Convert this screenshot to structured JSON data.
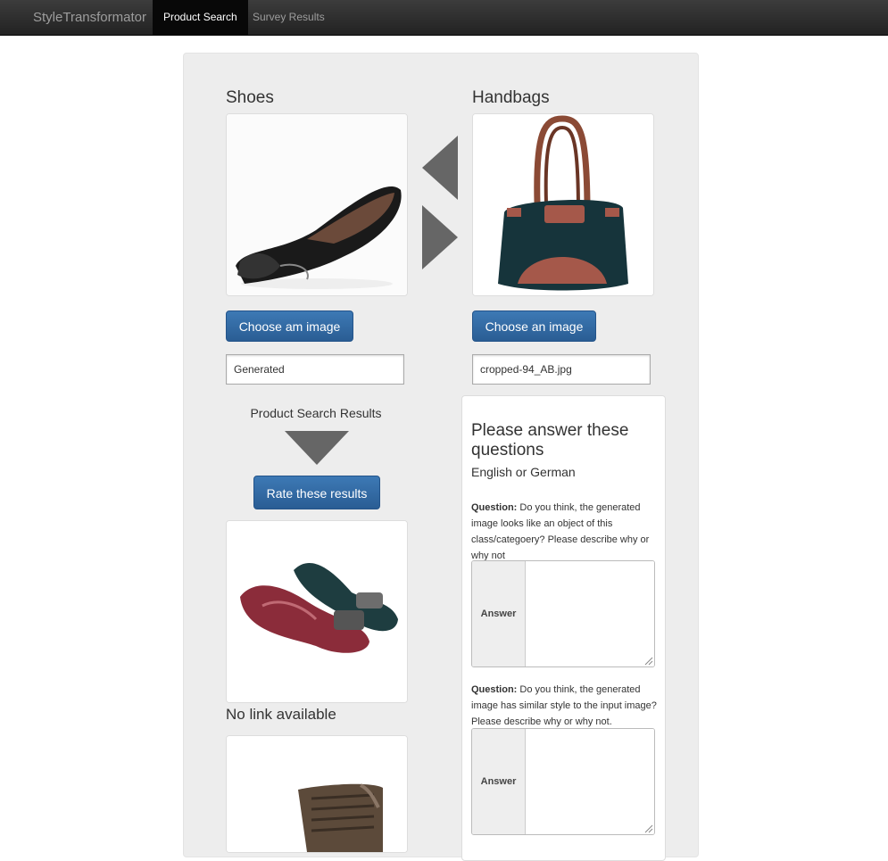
{
  "nav": {
    "brand": "StyleTransformator",
    "tabs": [
      {
        "label": "Product Search",
        "active": true
      },
      {
        "label": "Survey Results",
        "active": false
      }
    ]
  },
  "left": {
    "title": "Shoes",
    "button": "Choose am image",
    "input_value": "Generated"
  },
  "right": {
    "title": "Handbags",
    "button": "Choose an image",
    "input_value": "cropped-94_AB.jpg"
  },
  "results": {
    "heading": "Product Search Results",
    "button": "Rate these results",
    "no_link": "No link available"
  },
  "survey": {
    "title": "Please answer these questions",
    "subtitle": "English or German",
    "questions": [
      {
        "prefix": "Question:",
        "text": " Do you think, the generated image looks like an object of this class/categoery? Please describe why or why not",
        "answer_label": "Answer"
      },
      {
        "prefix": "Question:",
        "text": " Do you think, the generated image has similar style to the input image? Please describe why or why not.",
        "answer_label": "Answer"
      }
    ]
  },
  "colors": {
    "primary": "#2a5d94",
    "navbar": "#222222",
    "well": "#ededed"
  },
  "icons": [
    "arrow-left-icon",
    "arrow-right-icon",
    "arrow-down-icon"
  ]
}
